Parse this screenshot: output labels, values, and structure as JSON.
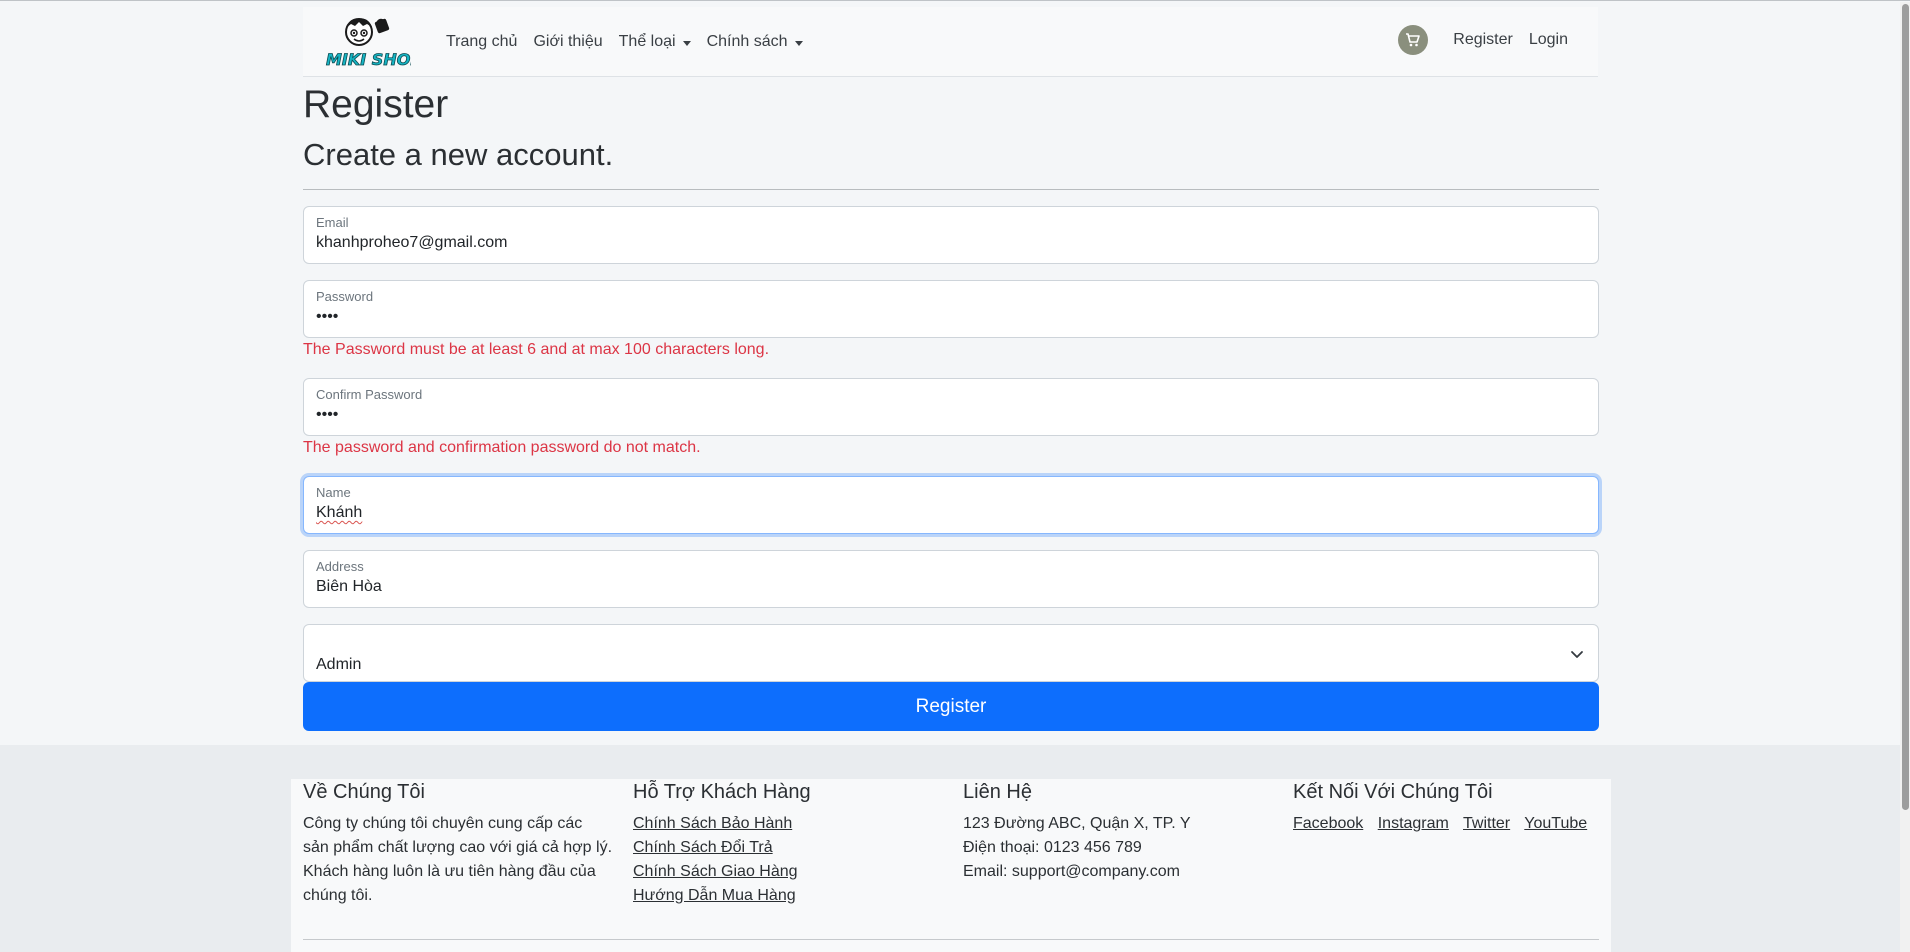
{
  "brand": {
    "logo_text": "MIKI SHOP"
  },
  "nav": {
    "items": [
      {
        "label": "Trang chủ"
      },
      {
        "label": "Giới thiệu"
      },
      {
        "label": "Thể loại"
      },
      {
        "label": "Chính sách"
      }
    ],
    "cart_icon": "shopping-cart-icon",
    "register": "Register",
    "login": "Login"
  },
  "page": {
    "title": "Register",
    "subtitle": "Create a new account."
  },
  "form": {
    "email": {
      "label": "Email",
      "value": "khanhproheo7@gmail.com"
    },
    "password": {
      "label": "Password",
      "value": "••••",
      "error": "The Password must be at least 6 and at max 100 characters long."
    },
    "confirm_password": {
      "label": "Confirm Password",
      "value": "••••",
      "error": "The password and confirmation password do not match."
    },
    "name": {
      "label": "Name",
      "value": "Khánh"
    },
    "address": {
      "label": "Address",
      "value": "Biên Hòa"
    },
    "role": {
      "value": "Admin"
    },
    "submit": "Register"
  },
  "footer": {
    "about": {
      "title": "Về Chúng Tôi",
      "lines": [
        "Công ty chúng tôi chuyên cung cấp các",
        "sản phẩm chất lượng cao với giá cả hợp lý.",
        "Khách hàng luôn là ưu tiên hàng đầu của",
        "chúng tôi."
      ]
    },
    "support": {
      "title": "Hỗ Trợ Khách Hàng",
      "links": [
        "Chính Sách Bảo Hành",
        "Chính Sách Đổi Trả",
        "Chính Sách Giao Hàng",
        "Hướng Dẫn Mua Hàng"
      ]
    },
    "contact": {
      "title": "Liên Hệ",
      "lines": [
        "123 Đường ABC, Quận X, TP. Y",
        "Điện thoại: 0123 456 789",
        "Email: support@company.com"
      ]
    },
    "social": {
      "title": "Kết Nối Với Chúng Tôi",
      "links": [
        "Facebook",
        "Instagram",
        "Twitter",
        "YouTube"
      ]
    }
  },
  "colors": {
    "primary": "#0d6efd",
    "error": "#dc3545",
    "cart": "#8a8f7d"
  }
}
